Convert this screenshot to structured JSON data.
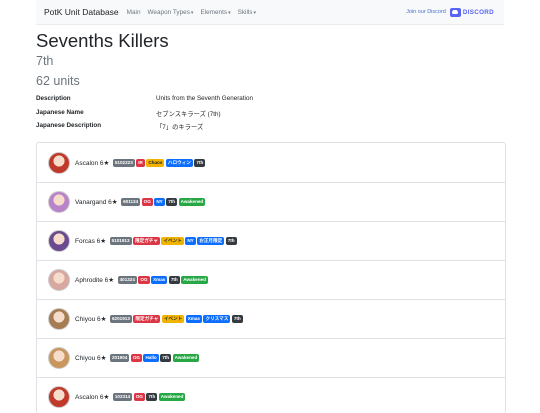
{
  "nav": {
    "brand": "PotK Unit Database",
    "links": [
      {
        "label": "Main",
        "dropdown": false
      },
      {
        "label": "Weapon Types",
        "dropdown": true
      },
      {
        "label": "Elements",
        "dropdown": true
      },
      {
        "label": "Skills",
        "dropdown": true
      }
    ],
    "join_text": "Join our Discord",
    "discord_text": "DISCORD"
  },
  "page": {
    "title": "Sevenths Killers",
    "subtitle": "7th",
    "count": "62 units"
  },
  "info": [
    {
      "label": "Description",
      "value": "Units from the Seventh Generation"
    },
    {
      "label": "Japanese Name",
      "value": "セブンスキラーズ (7th)"
    },
    {
      "label": "Japanese Description",
      "value": "「7」のキラーズ"
    }
  ],
  "units": [
    {
      "name": "Ascalon 6★",
      "avatar_color": "#c0392b",
      "badges": [
        {
          "text": "5102223",
          "color": "grey"
        },
        {
          "text": "IR",
          "color": "red"
        },
        {
          "text": "Chaos",
          "color": "yellow"
        },
        {
          "text": "ハロウィン",
          "color": "blue"
        },
        {
          "text": "7th",
          "color": "dark"
        }
      ]
    },
    {
      "name": "Vanargand 6★",
      "avatar_color": "#b983c9",
      "badges": [
        {
          "text": "601134",
          "color": "grey"
        },
        {
          "text": "OG",
          "color": "red"
        },
        {
          "text": "NY",
          "color": "blue"
        },
        {
          "text": "7th",
          "color": "dark"
        },
        {
          "text": "Awakened",
          "color": "green"
        }
      ]
    },
    {
      "name": "Forcas 6★",
      "avatar_color": "#6c4a8f",
      "badges": [
        {
          "text": "5101913",
          "color": "grey"
        },
        {
          "text": "限定ガチャ",
          "color": "red"
        },
        {
          "text": "イベント",
          "color": "yellow"
        },
        {
          "text": "NY",
          "color": "blue"
        },
        {
          "text": "お正月限定",
          "color": "blue"
        },
        {
          "text": "7th",
          "color": "dark"
        }
      ]
    },
    {
      "name": "Aphrodite 6★",
      "avatar_color": "#d8a8a0",
      "badges": [
        {
          "text": "401324",
          "color": "grey"
        },
        {
          "text": "OG",
          "color": "red"
        },
        {
          "text": "Xmas",
          "color": "blue"
        },
        {
          "text": "7th",
          "color": "dark"
        },
        {
          "text": "Awakened",
          "color": "green"
        }
      ]
    },
    {
      "name": "Chiyou 6★",
      "avatar_color": "#a67c52",
      "badges": [
        {
          "text": "6201913",
          "color": "grey"
        },
        {
          "text": "限定ガチャ",
          "color": "red"
        },
        {
          "text": "イベント",
          "color": "yellow"
        },
        {
          "text": "Xmas",
          "color": "blue"
        },
        {
          "text": "クリスマス",
          "color": "blue"
        },
        {
          "text": "7th",
          "color": "dark"
        }
      ]
    },
    {
      "name": "Chiyou 6★",
      "avatar_color": "#c9975e",
      "badges": [
        {
          "text": "201904",
          "color": "grey"
        },
        {
          "text": "OG",
          "color": "red"
        },
        {
          "text": "Hallo",
          "color": "blue"
        },
        {
          "text": "7th",
          "color": "dark"
        },
        {
          "text": "Awakened",
          "color": "green"
        }
      ]
    },
    {
      "name": "Ascalon 6★",
      "avatar_color": "#c0392b",
      "badges": [
        {
          "text": "102314",
          "color": "grey"
        },
        {
          "text": "OG",
          "color": "red"
        },
        {
          "text": "7th",
          "color": "dark"
        },
        {
          "text": "Awakened",
          "color": "green"
        }
      ]
    }
  ]
}
